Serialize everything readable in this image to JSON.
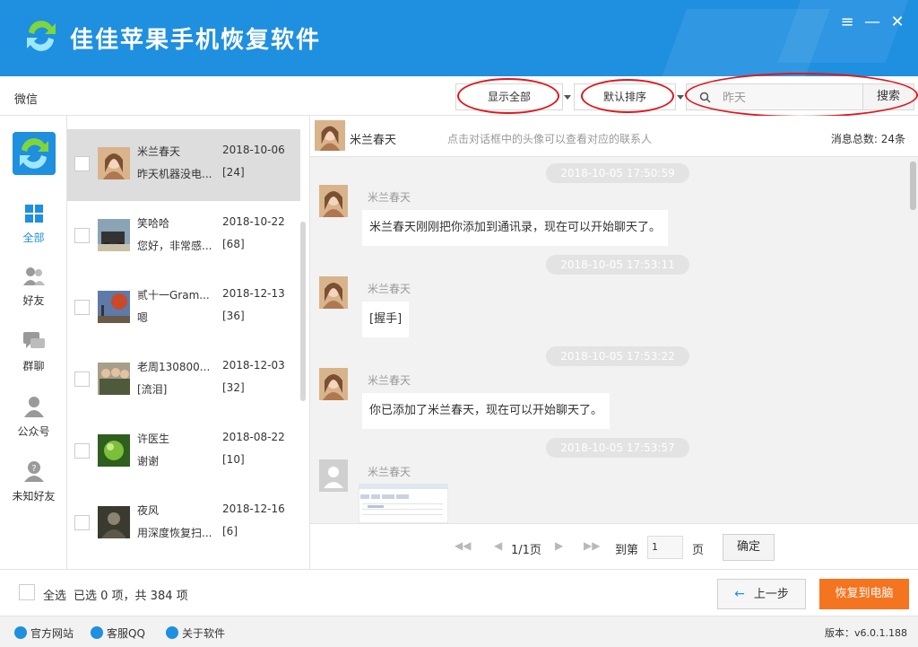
{
  "app": {
    "title": "佳佳苹果手机恢复软件"
  },
  "window_controls": {
    "menu": "≡",
    "minimize": "—",
    "close": "✕"
  },
  "toolbar": {
    "section_label": "微信",
    "filter_dropdown": "显示全部",
    "sort_dropdown": "默认排序",
    "search_value": "昨天",
    "search_button": "搜索"
  },
  "nav": {
    "items": [
      {
        "label": "全部",
        "icon": "grid-icon",
        "active": true
      },
      {
        "label": "好友",
        "icon": "friends-icon",
        "active": false
      },
      {
        "label": "群聊",
        "icon": "group-chat-icon",
        "active": false
      },
      {
        "label": "公众号",
        "icon": "official-account-icon",
        "active": false
      },
      {
        "label": "未知好友",
        "icon": "unknown-friend-icon",
        "active": false
      }
    ]
  },
  "contacts": [
    {
      "name": "米兰春天",
      "date": "2018-10-06",
      "preview": "昨天机器没电...",
      "count": "[24]",
      "selected": true
    },
    {
      "name": "笑哈哈",
      "date": "2018-10-22",
      "preview": "您好，非常感...",
      "count": "[68]",
      "selected": false
    },
    {
      "name": "贰十一Gram...",
      "date": "2018-12-13",
      "preview": "嗯",
      "count": "[36]",
      "selected": false
    },
    {
      "name": "老周130800...",
      "date": "2018-12-03",
      "preview": "[流泪]",
      "count": "[32]",
      "selected": false
    },
    {
      "name": "许医生",
      "date": "2018-08-22",
      "preview": "谢谢",
      "count": "[10]",
      "selected": false
    },
    {
      "name": "夜风",
      "date": "2018-12-16",
      "preview": "用深度恢复扫...",
      "count": "[6]",
      "selected": false
    }
  ],
  "chat": {
    "contact_name": "米兰春天",
    "hint": "点击对话框中的头像可以查看对应的联系人",
    "total": "消息总数: 24条",
    "messages": [
      {
        "time": "2018-10-05 17:50:59",
        "sender": "米兰春天",
        "text": "米兰春天刚刚把你添加到通讯录，现在可以开始聊天了。"
      },
      {
        "time": "2018-10-05 17:53:11",
        "sender": "米兰春天",
        "text": "[握手]"
      },
      {
        "time": "2018-10-05 17:53:22",
        "sender": "米兰春天",
        "text": "你已添加了米兰春天，现在可以开始聊天了。"
      },
      {
        "time": "2018-10-05 17:53:57",
        "sender": "米兰春天",
        "text": ""
      }
    ]
  },
  "pager": {
    "page_info": "1/1页",
    "goto_label": "到第",
    "page_input": "1",
    "page_unit": "页",
    "confirm": "确定"
  },
  "actions": {
    "select_all": "全选",
    "selection_status": "已选 0 项，共 384 项",
    "prev_step": "上一步",
    "restore": "恢复到电脑"
  },
  "footer": {
    "links": [
      "官方网站",
      "客服QQ",
      "关于软件"
    ],
    "version": "版本：v6.0.1.188"
  },
  "colors": {
    "brand": "#1f8fe0",
    "accent": "#f57420",
    "highlight": "#e0161c"
  }
}
